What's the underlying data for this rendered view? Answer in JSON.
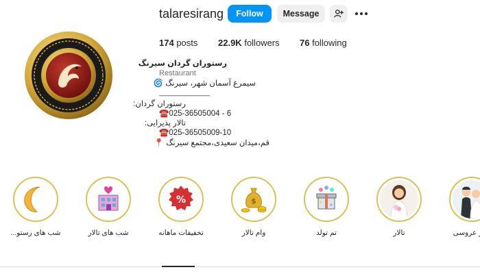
{
  "profile": {
    "username": "talaresirang",
    "follow_label": "Follow",
    "message_label": "Message",
    "avatar_icon": "restaurant-logo-emblem",
    "avatar_ring_text": "SIRANG RESTAURANT AND RECEPTION HALL COMPLEX"
  },
  "stats": {
    "posts_count": "174",
    "posts_label": "posts",
    "followers_count": "22.9K",
    "followers_label": "followers",
    "following_count": "76",
    "following_label": "following"
  },
  "bio": {
    "name": "رستوران گردان سیرنگ",
    "category": "Restaurant",
    "line1": "سیمرغ آسمان شهر، سیرنگ 🌀",
    "divider": "________________",
    "line2": "رستوران گردان:",
    "line3": "☎️025-36505004 - 6",
    "line4": "تالار پذیرایی:",
    "line5": "☎️025-36505009-10",
    "line6": "قم،میدان سعیدی،مجتمع سیرنگ 📍"
  },
  "highlights": [
    {
      "label": "شب های رستو...",
      "icon": "crescent-moon-icon"
    },
    {
      "label": "شب های تالار",
      "icon": "hotel-hearts-icon"
    },
    {
      "label": "تخفیفات ماهانه",
      "icon": "percent-badge-icon"
    },
    {
      "label": "وام تالار",
      "icon": "money-bag-icon"
    },
    {
      "label": "تم تولد",
      "icon": "gift-box-icon"
    },
    {
      "label": "تالار",
      "icon": "bride-icon"
    },
    {
      "label": "تالار عروسی",
      "icon": "wedding-couple-icon"
    }
  ],
  "colors": {
    "follow_button": "#0095f6",
    "secondary_button": "#efefef",
    "highlight_ring": "#d6c257",
    "logo_red": "#8b1a1a",
    "logo_gold": "#d4a93a"
  }
}
